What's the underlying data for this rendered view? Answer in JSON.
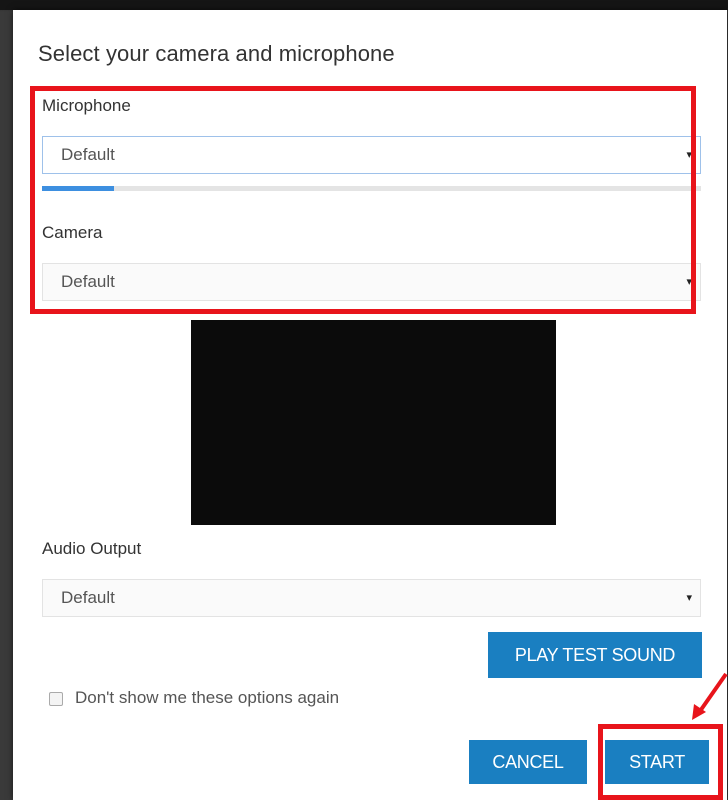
{
  "dialog": {
    "title": "Select your camera and microphone"
  },
  "microphone": {
    "label": "Microphone",
    "selected": "Default",
    "level_fraction": 0.11
  },
  "camera": {
    "label": "Camera",
    "selected": "Default"
  },
  "audio_output": {
    "label": "Audio Output",
    "selected": "Default"
  },
  "buttons": {
    "play_test_sound": "PLAY TEST SOUND",
    "cancel": "CANCEL",
    "start": "START"
  },
  "dont_show_checkbox": {
    "label": "Don't show me these options again",
    "checked": false
  },
  "icons": {
    "caret": "▾"
  },
  "colors": {
    "accent_button": "#1a7fc1",
    "highlight_annotation": "#e8141b",
    "level_meter": "#3d8fe0"
  }
}
